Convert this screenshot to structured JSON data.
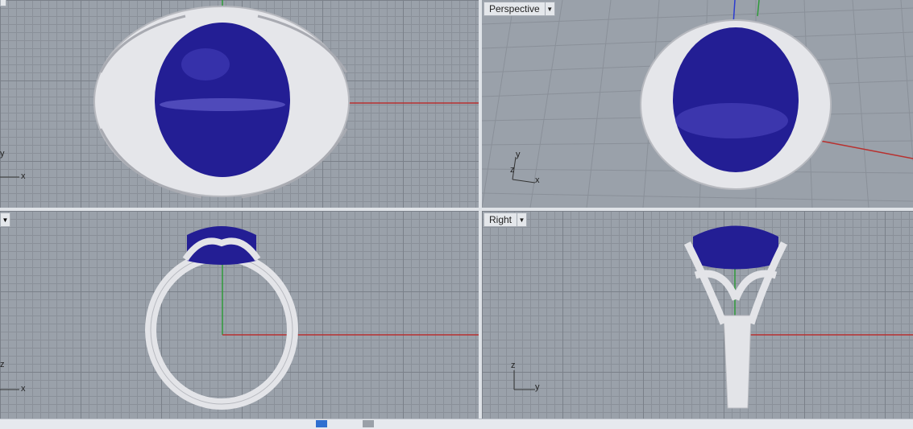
{
  "viewports": {
    "top": {
      "axis_labels": {
        "x": "x",
        "y": "y"
      }
    },
    "perspective": {
      "label": "Perspective",
      "axis_labels": {
        "x": "x",
        "y": "y",
        "z": "z"
      }
    },
    "front": {
      "axis_labels": {
        "x": "x",
        "z": "z"
      }
    },
    "right": {
      "label": "Right",
      "axis_labels": {
        "y": "y",
        "z": "z"
      }
    }
  },
  "colors": {
    "viewport_bg": "#9aa1aa",
    "x_axis": "#b8312f",
    "y_axis": "#2f9a3a",
    "z_axis": "#2b3bd0",
    "gem": "#1f1a8c",
    "metal": "#e8e9ec"
  },
  "icons": {
    "dropdown": "chevron-down-icon",
    "axis_gizmo": "axis-gizmo-icon"
  }
}
